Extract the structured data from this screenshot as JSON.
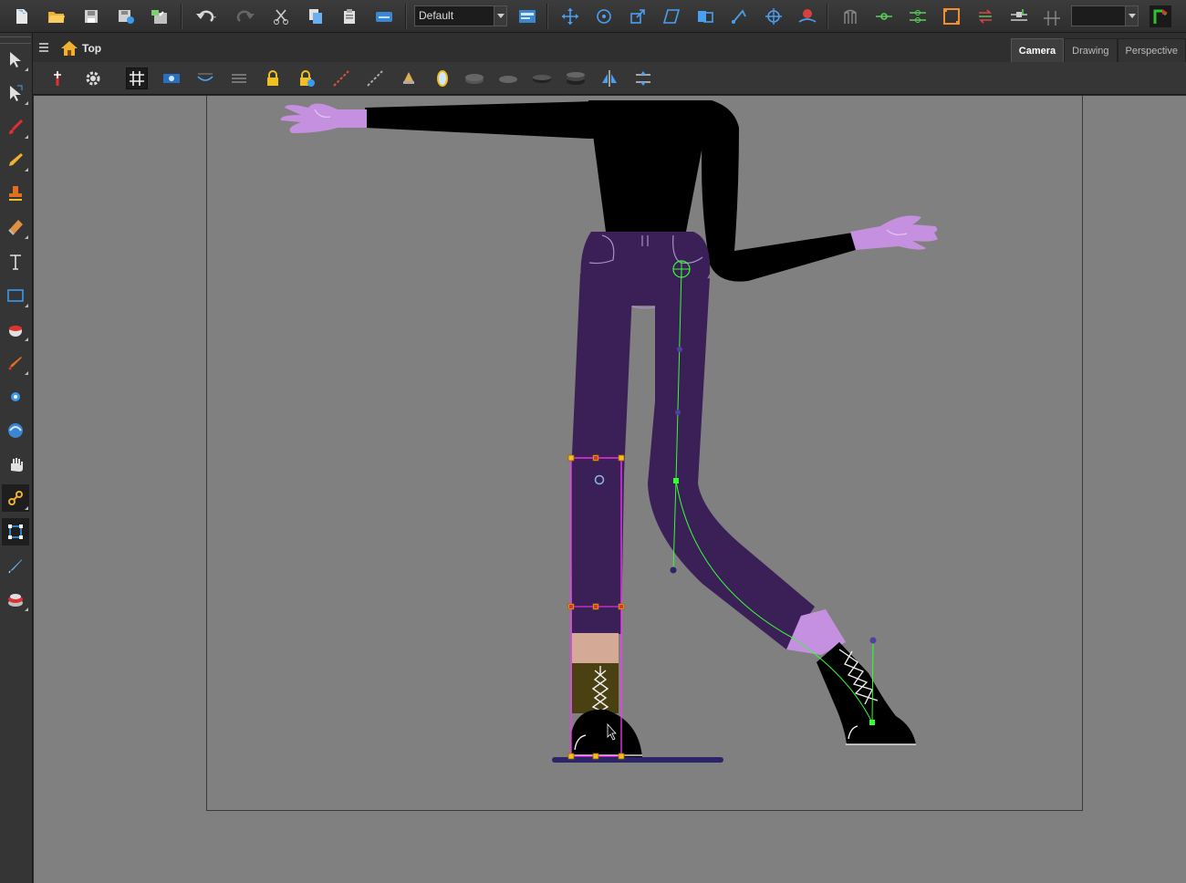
{
  "toolbar": {
    "workspace_value": "Default",
    "buttons": [
      "new-scene",
      "open-scene",
      "save",
      "save-as",
      "import",
      "undo",
      "redo",
      "cut",
      "copy",
      "paste",
      "library",
      "workspace-layout",
      "transform-move",
      "transform-rotate",
      "transform-scale",
      "transform-skew",
      "transform-flip",
      "transform-bone",
      "transform-pivot",
      "peg",
      "rig-a",
      "rig-b",
      "rig-c",
      "rig-d",
      "rig-e",
      "rig-f",
      "rig-g",
      "rig-h"
    ]
  },
  "breadcrumb": {
    "label": "Top"
  },
  "view_tabs": [
    {
      "label": "Camera",
      "active": true
    },
    {
      "label": "Drawing",
      "active": false
    },
    {
      "label": "Perspective",
      "active": false
    }
  ],
  "tools": [
    "select",
    "contour-editor",
    "brush",
    "pencil",
    "stamp",
    "eraser",
    "text",
    "rectangle",
    "paint-bucket",
    "dropper",
    "pivot",
    "pen",
    "hand",
    "rigging",
    "transform",
    "cutter",
    "paint"
  ],
  "active_tools": [
    "rigging",
    "transform"
  ],
  "colors": {
    "toolbar_bg": "#333333",
    "viewport_bg": "#808080",
    "pants": "#3b1f57",
    "skin": "#c590e0",
    "shirt": "#000000",
    "selection": "#ff33ff",
    "handle": "#f0c020",
    "bone": "#33ff33",
    "floor": "#2b2466"
  }
}
